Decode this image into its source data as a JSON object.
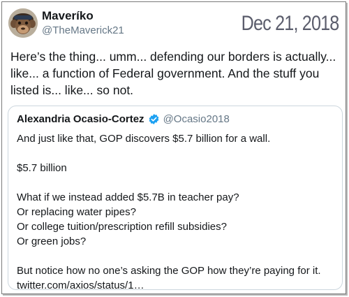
{
  "tweet": {
    "author_name": "Maveríko",
    "author_handle": "@TheMaverick21",
    "date_stamp": "Dec 21, 2018",
    "text": "Here’s the thing... umm... defending our borders is actually... like... a function of Federal government. And the stuff you listed is... like... so not.",
    "avatar_icon": "monkey-avatar"
  },
  "quoted_tweet": {
    "author_name": "Alexandria Ocasio-Cortez",
    "author_handle": "@Ocasio2018",
    "verified_icon": "verified-badge-icon",
    "verified_color": "#1da1f2",
    "paragraphs": [
      [
        "And just like that, GOP discovers $5.7 billion for a wall."
      ],
      [
        "$5.7 billion"
      ],
      [
        "What if we instead added $5.7B in teacher pay?",
        "Or replacing water pipes?",
        "Or college tuition/prescription refill subsidies?",
        "Or green jobs?"
      ],
      [
        "But notice how no one’s asking the GOP how they’re paying for it.",
        "twitter.com/axios/status/1…"
      ]
    ]
  }
}
